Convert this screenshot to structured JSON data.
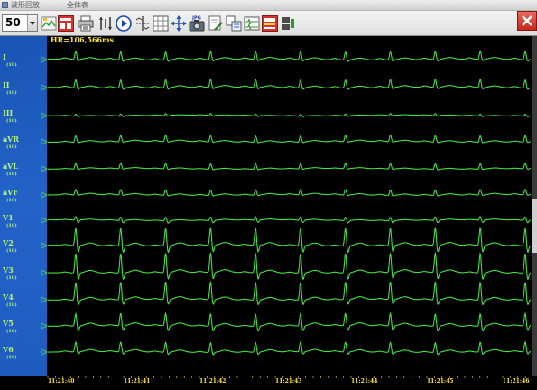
{
  "tabs": [
    {
      "label": "波形回放"
    },
    {
      "label": "全体表"
    }
  ],
  "toolbar": {
    "zoom_value": "50",
    "icons": [
      "image-icon",
      "report-icon",
      "printer-icon",
      "gain-icon",
      "play-icon",
      "speed-icon",
      "grid-icon",
      "move-icon",
      "jpg-export-icon",
      "edit-icon",
      "measure-icon",
      "compare-icon",
      "analysis-icon",
      "split-icon"
    ],
    "jpg_label": "JPG"
  },
  "window": {
    "close_icon": "close-icon"
  },
  "ecg": {
    "hr": "HR=106,566ms",
    "leads": [
      {
        "name": "I",
        "gain": "(10)"
      },
      {
        "name": "II",
        "gain": "(10)"
      },
      {
        "name": "III",
        "gain": "(10)"
      },
      {
        "name": "aVR",
        "gain": "(10)"
      },
      {
        "name": "aVL",
        "gain": "(10)"
      },
      {
        "name": "aVF",
        "gain": "(10)"
      },
      {
        "name": "V1",
        "gain": "(10)"
      },
      {
        "name": "V2",
        "gain": "(10)"
      },
      {
        "name": "V3",
        "gain": "(10)"
      },
      {
        "name": "V4",
        "gain": "(10)"
      },
      {
        "name": "V5",
        "gain": "(10)"
      },
      {
        "name": "V6",
        "gain": "(10)"
      }
    ],
    "time_labels": [
      "11:21:40",
      "11:21:41",
      "11:21:42",
      "11:21:43",
      "11:21:44",
      "11:21:45",
      "11:21:46"
    ]
  },
  "colors": {
    "trace": "#46e046",
    "lead_panel": "#1f5fc4",
    "hr_text": "#ffe23a",
    "time_text": "#ffe23a",
    "lead_label": "#b7f27a",
    "close": "#d8342c"
  }
}
